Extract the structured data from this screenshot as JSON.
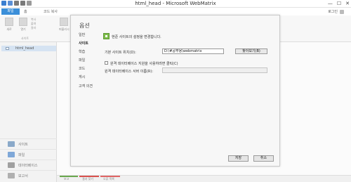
{
  "window": {
    "title": "html_head - Microsoft WebMatrix",
    "minimize_glyph": "—",
    "maximize_glyph": "☐",
    "close_glyph": "✕"
  },
  "quick_access": {
    "icons": [
      "save-icon",
      "save-all-icon",
      "undo-icon",
      "redo-icon",
      "dropdown-icon"
    ],
    "colors": [
      "#3b7fd0",
      "#5a8fd6",
      "#7a7a7a",
      "#7a7a7a",
      "#9a9a9a"
    ]
  },
  "ribbon_tabs": {
    "file": "파일",
    "home": "홈",
    "insert": "코드 복사"
  },
  "account": {
    "user": "로그인"
  },
  "ribbon": {
    "new": "새로",
    "open": "열기",
    "remote_group": "원격",
    "small_1": "복사",
    "small_2": "붙여",
    "small_3": "잘라",
    "group_site": "사이트",
    "publish": "게시",
    "publish_label": "퍼블리시",
    "run": "실행",
    "run_label": "브라우저로 실행"
  },
  "tree": {
    "item": "html_head"
  },
  "workspaces": [
    {
      "label": "사이트",
      "icon": "site-icon",
      "color": "#8aa9c9"
    },
    {
      "label": "파일",
      "icon": "files-icon",
      "color": "#7fa8d8"
    },
    {
      "label": "데이터베이스",
      "icon": "database-icon",
      "color": "#a0a0a0"
    },
    {
      "label": "보고서",
      "icon": "reports-icon",
      "color": "#b0b0b0"
    }
  ],
  "status": {
    "tabs": [
      "보고",
      "결과 찾기",
      "오류 목록"
    ],
    "line_colors": [
      "#6aa84f",
      "#d9534f",
      "#e06666"
    ]
  },
  "dialog": {
    "title": "옵션",
    "nav": [
      "일반",
      "사이트",
      "학습",
      "파일",
      "코드",
      "게시",
      "고객 의견"
    ],
    "active_nav": "사이트",
    "info": "현준 사이트의 설정을 변경합니다.",
    "default_location_label": "기본 사이트 위치(D):",
    "default_location_value": "D:\\#공부용\\webmatrix",
    "browse": "찾아보기(B)",
    "remote_checkbox_label": "원격 데이터베이스 지원을 사용하려면 클릭(C)",
    "remote_checked": false,
    "remote_server_label": "원격 데이터베이스 서버 이름(R):",
    "remote_server_value": "",
    "ok": "저장",
    "cancel": "취소"
  }
}
